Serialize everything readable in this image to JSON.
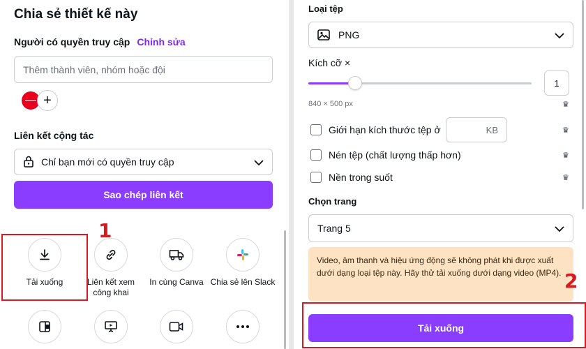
{
  "left": {
    "title": "Chia sẻ thiết kế này",
    "access_label": "Người có quyền truy cập",
    "edit_link": "Chỉnh sửa",
    "member_input_placeholder": "Thêm thành viên, nhóm hoặc đội",
    "collab_label": "Liên kết cộng tác",
    "access_value": "Chỉ bạn mới có quyền truy cập",
    "copy_link_label": "Sao chép liên kết",
    "share_options": [
      {
        "label": "Tải xuống",
        "icon": "download-icon"
      },
      {
        "label": "Liên kết xem công khai",
        "icon": "link-icon"
      },
      {
        "label": "In cùng Canva",
        "icon": "truck-icon"
      },
      {
        "label": "Chia sẻ lên Slack",
        "icon": "slack-icon"
      }
    ],
    "more_icons": [
      "layout-icon",
      "presentation-icon",
      "video-camera-icon",
      "more-icon"
    ],
    "marker_1": "1"
  },
  "right": {
    "file_type_label": "Loại tệp",
    "file_type_value": "PNG",
    "size_label": "Kích cỡ ×",
    "size_value": "1",
    "size_slider_fraction": 0.21,
    "dimensions": "840 × 500 px",
    "limit_size_label": "Giới hạn kích thước tệp ở",
    "kb_unit": "KB",
    "compress_label": "Nén tệp (chất lượng thấp hơn)",
    "transparent_label": "Nền trong suốt",
    "page_label": "Chọn trang",
    "page_value": "Trang 5",
    "notice": "Video, âm thanh và hiệu ứng động sẽ không phát khi được xuất dưới dạng loại tệp này. Hãy thử tải xuống dưới dạng video (MP4).",
    "download_label": "Tải xuống",
    "marker_2": "2"
  },
  "colors": {
    "accent": "#8b3dff",
    "annotation": "#d71920",
    "notice_bg": "#fde2c3"
  }
}
